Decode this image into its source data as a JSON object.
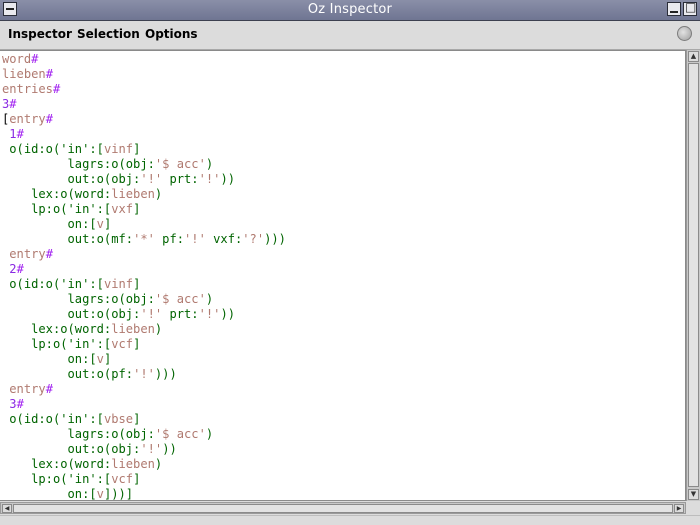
{
  "window": {
    "title": "Oz Inspector"
  },
  "menubar": {
    "items": [
      "Inspector",
      "Selection",
      "Options"
    ]
  },
  "colors": {
    "symbol": "#006400",
    "atom": "#b07a70",
    "number": "#8a2be2",
    "tag": "#a020f0",
    "bracket": "#000000"
  },
  "code": {
    "lines": [
      [
        {
          "t": "word",
          "c": "atom"
        },
        {
          "t": "#",
          "c": "tag"
        }
      ],
      [
        {
          "t": "lieben",
          "c": "atom"
        },
        {
          "t": "#",
          "c": "tag"
        }
      ],
      [
        {
          "t": "entries",
          "c": "atom"
        },
        {
          "t": "#",
          "c": "tag"
        }
      ],
      [
        {
          "t": "3",
          "c": "num"
        },
        {
          "t": "#",
          "c": "tag"
        }
      ],
      [
        {
          "t": "[",
          "c": "br"
        },
        {
          "t": "entry",
          "c": "atom"
        },
        {
          "t": "#",
          "c": "tag"
        }
      ],
      [
        {
          "t": " 1",
          "c": "num"
        },
        {
          "t": "#",
          "c": "tag"
        }
      ],
      [
        {
          "t": " o(id:o(",
          "c": "sym"
        },
        {
          "t": "'in'",
          "c": "sym"
        },
        {
          "t": ":[",
          "c": "sym"
        },
        {
          "t": "vinf",
          "c": "atom"
        },
        {
          "t": "]",
          "c": "sym"
        }
      ],
      [
        {
          "t": "         lagrs:o(obj:",
          "c": "sym"
        },
        {
          "t": "'$ acc'",
          "c": "atom"
        },
        {
          "t": ")",
          "c": "sym"
        }
      ],
      [
        {
          "t": "         out:o(obj:",
          "c": "sym"
        },
        {
          "t": "'!'",
          "c": "atom"
        },
        {
          "t": " prt:",
          "c": "sym"
        },
        {
          "t": "'!'",
          "c": "atom"
        },
        {
          "t": "))",
          "c": "sym"
        }
      ],
      [
        {
          "t": "    lex:o(word:",
          "c": "sym"
        },
        {
          "t": "lieben",
          "c": "atom"
        },
        {
          "t": ")",
          "c": "sym"
        }
      ],
      [
        {
          "t": "    lp:o(",
          "c": "sym"
        },
        {
          "t": "'in'",
          "c": "sym"
        },
        {
          "t": ":[",
          "c": "sym"
        },
        {
          "t": "vxf",
          "c": "atom"
        },
        {
          "t": "]",
          "c": "sym"
        }
      ],
      [
        {
          "t": "         on:[",
          "c": "sym"
        },
        {
          "t": "v",
          "c": "atom"
        },
        {
          "t": "]",
          "c": "sym"
        }
      ],
      [
        {
          "t": "         out:o(mf:",
          "c": "sym"
        },
        {
          "t": "'*'",
          "c": "atom"
        },
        {
          "t": " pf:",
          "c": "sym"
        },
        {
          "t": "'!'",
          "c": "atom"
        },
        {
          "t": " vxf:",
          "c": "sym"
        },
        {
          "t": "'?'",
          "c": "atom"
        },
        {
          "t": ")))",
          "c": "sym"
        }
      ],
      [
        {
          "t": " entry",
          "c": "atom"
        },
        {
          "t": "#",
          "c": "tag"
        }
      ],
      [
        {
          "t": " 2",
          "c": "num"
        },
        {
          "t": "#",
          "c": "tag"
        }
      ],
      [
        {
          "t": " o(id:o(",
          "c": "sym"
        },
        {
          "t": "'in'",
          "c": "sym"
        },
        {
          "t": ":[",
          "c": "sym"
        },
        {
          "t": "vinf",
          "c": "atom"
        },
        {
          "t": "]",
          "c": "sym"
        }
      ],
      [
        {
          "t": "         lagrs:o(obj:",
          "c": "sym"
        },
        {
          "t": "'$ acc'",
          "c": "atom"
        },
        {
          "t": ")",
          "c": "sym"
        }
      ],
      [
        {
          "t": "         out:o(obj:",
          "c": "sym"
        },
        {
          "t": "'!'",
          "c": "atom"
        },
        {
          "t": " prt:",
          "c": "sym"
        },
        {
          "t": "'!'",
          "c": "atom"
        },
        {
          "t": "))",
          "c": "sym"
        }
      ],
      [
        {
          "t": "    lex:o(word:",
          "c": "sym"
        },
        {
          "t": "lieben",
          "c": "atom"
        },
        {
          "t": ")",
          "c": "sym"
        }
      ],
      [
        {
          "t": "    lp:o(",
          "c": "sym"
        },
        {
          "t": "'in'",
          "c": "sym"
        },
        {
          "t": ":[",
          "c": "sym"
        },
        {
          "t": "vcf",
          "c": "atom"
        },
        {
          "t": "]",
          "c": "sym"
        }
      ],
      [
        {
          "t": "         on:[",
          "c": "sym"
        },
        {
          "t": "v",
          "c": "atom"
        },
        {
          "t": "]",
          "c": "sym"
        }
      ],
      [
        {
          "t": "         out:o(pf:",
          "c": "sym"
        },
        {
          "t": "'!'",
          "c": "atom"
        },
        {
          "t": ")))",
          "c": "sym"
        }
      ],
      [
        {
          "t": " entry",
          "c": "atom"
        },
        {
          "t": "#",
          "c": "tag"
        }
      ],
      [
        {
          "t": " 3",
          "c": "num"
        },
        {
          "t": "#",
          "c": "tag"
        }
      ],
      [
        {
          "t": " o(id:o(",
          "c": "sym"
        },
        {
          "t": "'in'",
          "c": "sym"
        },
        {
          "t": ":[",
          "c": "sym"
        },
        {
          "t": "vbse",
          "c": "atom"
        },
        {
          "t": "]",
          "c": "sym"
        }
      ],
      [
        {
          "t": "         lagrs:o(obj:",
          "c": "sym"
        },
        {
          "t": "'$ acc'",
          "c": "atom"
        },
        {
          "t": ")",
          "c": "sym"
        }
      ],
      [
        {
          "t": "         out:o(obj:",
          "c": "sym"
        },
        {
          "t": "'!'",
          "c": "atom"
        },
        {
          "t": "))",
          "c": "sym"
        }
      ],
      [
        {
          "t": "    lex:o(word:",
          "c": "sym"
        },
        {
          "t": "lieben",
          "c": "atom"
        },
        {
          "t": ")",
          "c": "sym"
        }
      ],
      [
        {
          "t": "    lp:o(",
          "c": "sym"
        },
        {
          "t": "'in'",
          "c": "sym"
        },
        {
          "t": ":[",
          "c": "sym"
        },
        {
          "t": "vcf",
          "c": "atom"
        },
        {
          "t": "]",
          "c": "sym"
        }
      ],
      [
        {
          "t": "         on:[",
          "c": "sym"
        },
        {
          "t": "v",
          "c": "atom"
        },
        {
          "t": "]))]",
          "c": "sym"
        }
      ]
    ]
  }
}
